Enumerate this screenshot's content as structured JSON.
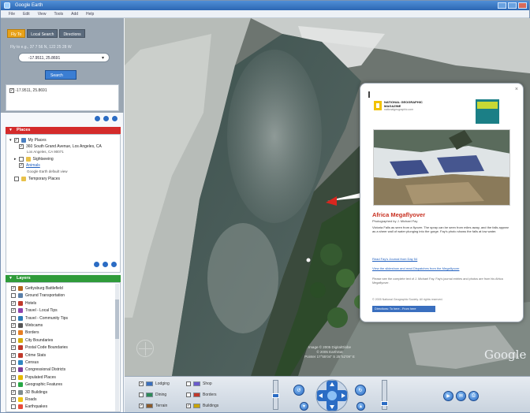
{
  "window": {
    "title": "Google Earth",
    "menu": [
      "File",
      "Edit",
      "View",
      "Tools",
      "Add",
      "Help"
    ]
  },
  "search": {
    "tabs": [
      "Fly To",
      "Local Search",
      "Directions"
    ],
    "hint": "Fly to e.g., 37 7 56 N, 122 25 28 W",
    "query": "-17.9511, 25.8691",
    "button": "Search",
    "result": "-17.9511, 25.8691"
  },
  "places": {
    "header": "Places",
    "items": [
      {
        "label": "My Places",
        "checked": true
      },
      {
        "label": "360 South Grand Avenue, Los Angeles, CA",
        "sub": "Los Angeles, CA 90071",
        "checked": true
      },
      {
        "label": "Sightseeing",
        "checked": false
      },
      {
        "label": "Animals",
        "checked": true,
        "link": true
      },
      {
        "label": "Temporary Places",
        "checked": false
      }
    ],
    "note": "Google Earth default view"
  },
  "layers": {
    "header": "Layers",
    "items": [
      {
        "label": "Gettysburg Battlefield",
        "color": "#b5651d"
      },
      {
        "label": "Ground Transportation",
        "color": "#5a7fa8"
      },
      {
        "label": "Hotels",
        "color": "#c0392b"
      },
      {
        "label": "Travel - Local Tips",
        "color": "#8e44ad"
      },
      {
        "label": "Travel - Community Tips",
        "color": "#2c7bb6"
      },
      {
        "label": "Webcams",
        "color": "#555555"
      },
      {
        "label": "Borders",
        "color": "#e67e22"
      },
      {
        "label": "City Boundaries",
        "color": "#d4ac0d"
      },
      {
        "label": "Postal Code Boundaries",
        "color": "#c0392b"
      },
      {
        "label": "Crime Stats",
        "color": "#c0392b"
      },
      {
        "label": "Census",
        "color": "#2e86c1"
      },
      {
        "label": "Congressional Districts",
        "color": "#7d3c98"
      },
      {
        "label": "Populated Places",
        "color": "#e6b800"
      },
      {
        "label": "Geographic Features",
        "color": "#28a745"
      },
      {
        "label": "3D Buildings",
        "color": "#7f8c8d"
      },
      {
        "label": "Roads",
        "color": "#f1c40f"
      },
      {
        "label": "Earthquakes",
        "color": "#e74c3c"
      }
    ]
  },
  "balloon": {
    "publisher": "NATIONAL GEOGRAPHIC",
    "publisher_sub": "MAGAZINE",
    "publisher_url": "nationalgeographic.com",
    "title": "Africa Megaflyover",
    "credit": "Photographed by J. Michael Fay",
    "body": "Victoria Falls as seen from a flyover. The spray can be seen from miles away, and the falls appear as a sheer wall of water plunging into the gorge. Fay's photo shows the falls at low water.",
    "link1": "Read Fay's Journal from Day 54",
    "link2": "View the slideshow and read Dispatches from the Megaflyover",
    "note": "Please see the complete text of J. Michael Fay. Fay's journal entries and photos are from his Africa Megaflyover.",
    "footer": "© 2005 National Geographic Society. All rights reserved.",
    "directions": "Directions: To here - From here"
  },
  "map": {
    "copyright": [
      "Image © 2005 DigitalGlobe",
      "© 2005 EarthSat",
      "Pointer 17°55'04\" S 25°52'09\" E"
    ],
    "logo": "Google"
  },
  "navbar": {
    "layers_left": [
      "Lodging",
      "Dining",
      "Terrain"
    ],
    "layers_right": [
      "Shop",
      "Borders",
      "Buildings"
    ],
    "colors": {
      "lodging": "#3a6fbf",
      "dining": "#2e8b57",
      "terrain": "#8b5a2b",
      "shop": "#6a5acd",
      "borders": "#c0392b",
      "buildings": "#c9a400"
    }
  }
}
